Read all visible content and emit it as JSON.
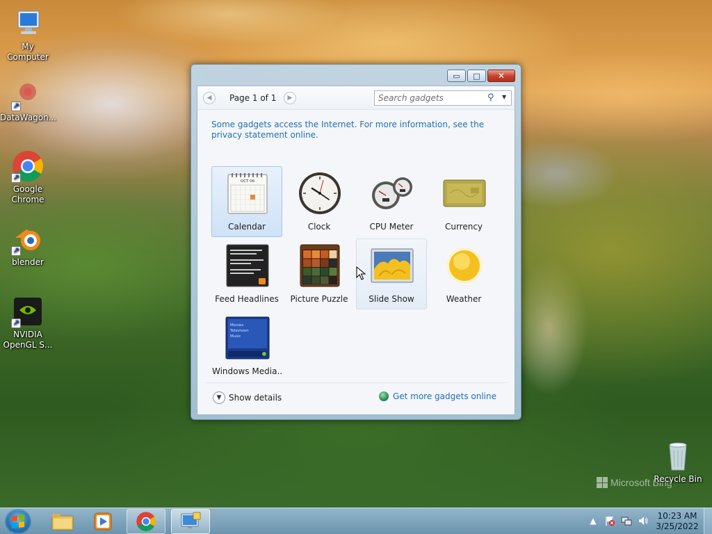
{
  "desktop": {
    "icons": [
      {
        "label": "My Computer",
        "icon": "computer-icon"
      },
      {
        "label": "DataWagon...",
        "icon": "datawagon-icon"
      },
      {
        "label": "Google Chrome",
        "icon": "chrome-icon"
      },
      {
        "label": "blender",
        "icon": "blender-icon"
      },
      {
        "label": "NVIDIA OpenGL S...",
        "icon": "nvidia-icon"
      },
      {
        "label": "Recycle Bin",
        "icon": "recycle-bin-icon"
      }
    ],
    "watermark": "Microsoft Bing"
  },
  "window": {
    "controls": {
      "minimize": "▭",
      "maximize": "□",
      "close": "✕"
    },
    "toolbar": {
      "page_label": "Page 1 of 1",
      "prev": "◀",
      "next": "▶",
      "search_placeholder": "Search gadgets"
    },
    "notice": "Some gadgets access the Internet.  For more information, see the privacy statement online.",
    "gadgets": [
      {
        "label": "Calendar",
        "icon": "calendar-gadget-icon",
        "state": "selected",
        "cal_header": "OCT 06"
      },
      {
        "label": "Clock",
        "icon": "clock-gadget-icon",
        "state": "normal"
      },
      {
        "label": "CPU Meter",
        "icon": "cpu-meter-gadget-icon",
        "state": "normal"
      },
      {
        "label": "Currency",
        "icon": "currency-gadget-icon",
        "state": "normal"
      },
      {
        "label": "Feed Headlines",
        "icon": "feed-headlines-gadget-icon",
        "state": "normal"
      },
      {
        "label": "Picture Puzzle",
        "icon": "picture-puzzle-gadget-icon",
        "state": "normal"
      },
      {
        "label": "Slide Show",
        "icon": "slide-show-gadget-icon",
        "state": "hover"
      },
      {
        "label": "Weather",
        "icon": "weather-gadget-icon",
        "state": "normal"
      },
      {
        "label": "Windows Media...",
        "icon": "windows-media-gadget-icon",
        "state": "normal",
        "menu_lines": [
          "Movies",
          "Television",
          "Music"
        ]
      }
    ],
    "footer": {
      "show_details": "Show details",
      "get_more": "Get more gadgets online"
    }
  },
  "taskbar": {
    "pinned": [
      "file-explorer-icon",
      "media-player-icon",
      "chrome-icon",
      "gadgets-window-icon"
    ],
    "tray": [
      "show-hidden-icons-arrow",
      "action-center-flag-icon",
      "network-icon",
      "volume-icon"
    ],
    "time": "10:23 AM",
    "date": "3/25/2022"
  }
}
